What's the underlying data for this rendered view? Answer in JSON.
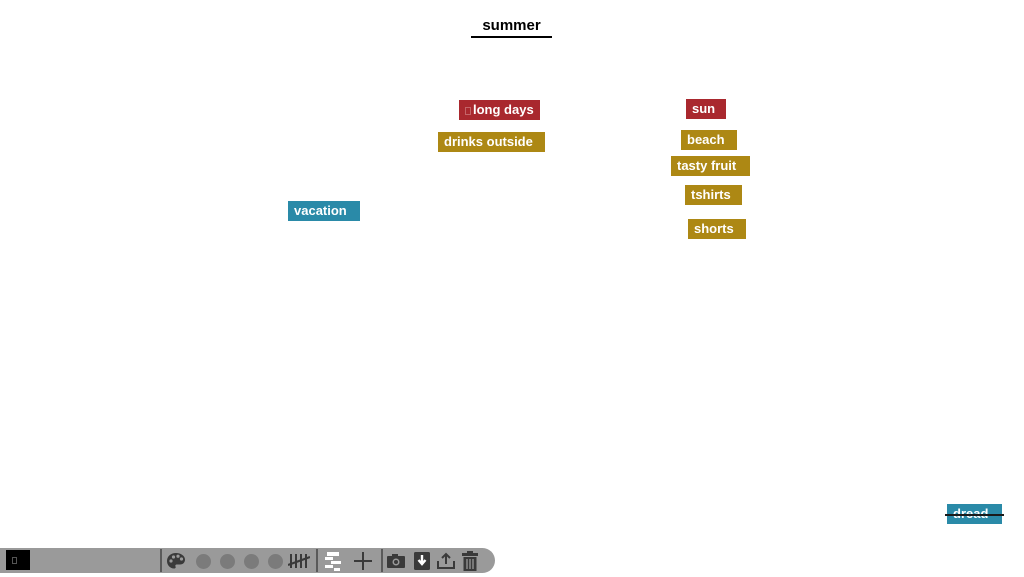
{
  "canvas": {
    "title": "summer",
    "tags": [
      {
        "label": "long days",
        "color": "red",
        "selected": true
      },
      {
        "label": "drinks outside",
        "color": "gold"
      },
      {
        "label": "sun",
        "color": "red"
      },
      {
        "label": "beach",
        "color": "gold"
      },
      {
        "label": "tasty fruit",
        "color": "gold"
      },
      {
        "label": "tshirts",
        "color": "gold"
      },
      {
        "label": "shorts",
        "color": "gold"
      },
      {
        "label": "vacation",
        "color": "blue"
      },
      {
        "label": "dread",
        "color": "blue",
        "struck_through": true
      }
    ],
    "colors": {
      "red": "#a9282e",
      "gold": "#ad8814",
      "blue": "#2a8aa8"
    }
  },
  "toolbar": {
    "current_color": "#000000",
    "icons": [
      "palette-icon",
      "color-dot-1",
      "color-dot-2",
      "color-dot-3",
      "color-dot-4",
      "tally-icon",
      "layout-icon",
      "add-icon",
      "camera-icon",
      "download-icon",
      "upload-icon",
      "trash-icon"
    ]
  }
}
